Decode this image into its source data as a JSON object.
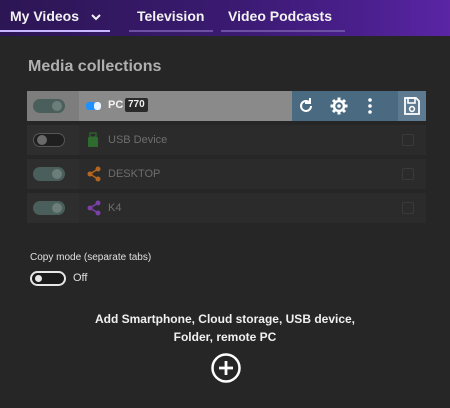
{
  "nav": {
    "tabs": [
      {
        "label": "My Videos",
        "active": true
      },
      {
        "label": "Television",
        "active": false
      },
      {
        "label": "Video Podcasts",
        "active": false
      }
    ]
  },
  "section_title": "Media collections",
  "collections": [
    {
      "name": "PC",
      "count": "770",
      "enabled": true,
      "selected": true,
      "icon": "windows-pc-icon",
      "icon_color": "#1e90ff"
    },
    {
      "name": "USB Device",
      "enabled": false,
      "selected": false,
      "icon": "usb-drive-icon",
      "icon_color": "#2f6b2f"
    },
    {
      "name": "DESKTOP",
      "enabled": true,
      "selected": false,
      "icon": "share-network-icon",
      "icon_color": "#b5651d"
    },
    {
      "name": "K4",
      "enabled": true,
      "selected": false,
      "icon": "share-network-icon",
      "icon_color": "#7b3fa8"
    }
  ],
  "row_actions": [
    "refresh-icon",
    "gear-icon",
    "more-vertical-icon",
    "save-icon"
  ],
  "copy_mode": {
    "label": "Copy mode (separate tabs)",
    "state": "Off"
  },
  "add": {
    "line1": "Add Smartphone, Cloud storage, USB device,",
    "line2": "Folder, remote PC",
    "icon": "plus-circle-icon"
  },
  "colors": {
    "accent": "#5b25a6",
    "selected_row": "#7d7d7d",
    "actions_bg": "#4a6a82"
  }
}
